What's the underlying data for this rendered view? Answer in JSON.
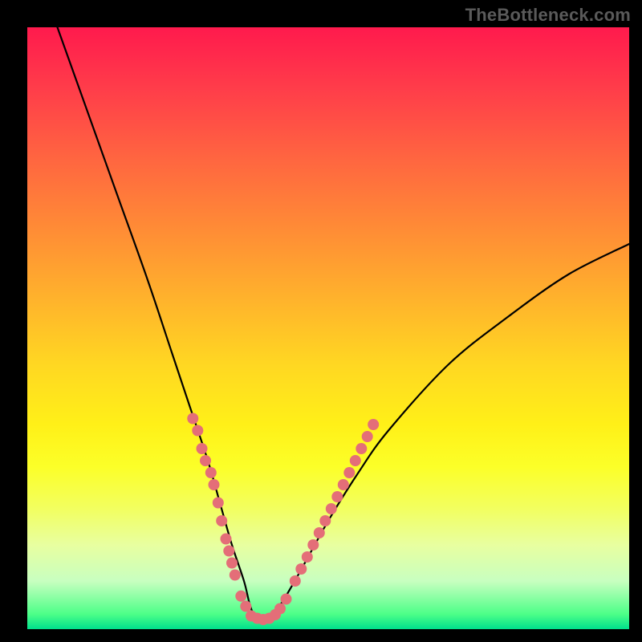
{
  "watermark": "TheBottleneck.com",
  "colors": {
    "gradient_top": "#ff1a4d",
    "gradient_mid_orange": "#ff8a36",
    "gradient_yellow": "#fff018",
    "gradient_bottom": "#00e08c",
    "curve": "#000000",
    "dots": "#e46e78",
    "frame": "#000000"
  },
  "chart_data": {
    "type": "line",
    "title": "",
    "xlabel": "",
    "ylabel": "",
    "xlim": [
      0,
      100
    ],
    "ylim": [
      0,
      100
    ],
    "grid": false,
    "legend": false,
    "series": [
      {
        "name": "bottleneck-curve",
        "x": [
          5,
          10,
          15,
          20,
          24,
          27,
          30,
          32,
          34,
          36,
          37,
          38,
          40,
          42,
          45,
          50,
          55,
          60,
          70,
          80,
          90,
          100
        ],
        "y": [
          100,
          86,
          72,
          58,
          46,
          37,
          28,
          21,
          14,
          8,
          4,
          2,
          2,
          4,
          9,
          18,
          26,
          33,
          44,
          52,
          59,
          64
        ]
      }
    ],
    "annotations": [
      {
        "name": "left-dot-cluster",
        "type": "scatter",
        "x": [
          27.5,
          28.3,
          29.0,
          29.6,
          30.5,
          31.0,
          31.7,
          32.3,
          33.0,
          33.5,
          34.0,
          34.5
        ],
        "y": [
          35,
          33,
          30,
          28,
          26,
          24,
          21,
          18,
          15,
          13,
          11,
          9
        ]
      },
      {
        "name": "valley-dot-cluster",
        "type": "scatter",
        "x": [
          35.5,
          36.3,
          37.2,
          38.2,
          39.2,
          40.2,
          41.2,
          42.0,
          43.0
        ],
        "y": [
          5.5,
          3.8,
          2.2,
          1.8,
          1.6,
          1.8,
          2.4,
          3.4,
          5.0
        ]
      },
      {
        "name": "right-dot-cluster",
        "type": "scatter",
        "x": [
          44.5,
          45.5,
          46.5,
          47.5,
          48.5,
          49.5,
          50.5,
          51.5,
          52.5,
          53.5,
          54.5,
          55.5,
          56.5,
          57.5
        ],
        "y": [
          8,
          10,
          12,
          14,
          16,
          18,
          20,
          22,
          24,
          26,
          28,
          30,
          32,
          34
        ]
      }
    ]
  }
}
